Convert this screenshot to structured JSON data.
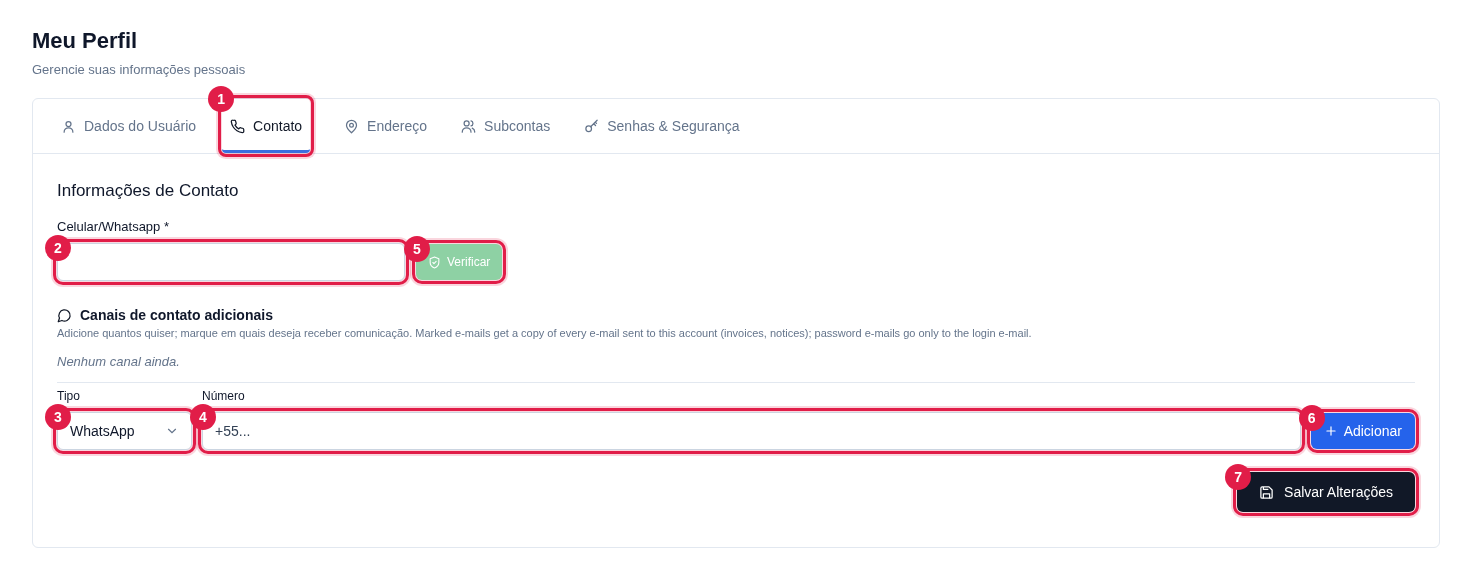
{
  "page": {
    "title": "Meu Perfil",
    "subtitle": "Gerencie suas informações pessoais"
  },
  "tabs": [
    {
      "label": "Dados do Usuário",
      "selected": false
    },
    {
      "label": "Contato",
      "selected": true,
      "marker": "1"
    },
    {
      "label": "Endereço",
      "selected": false
    },
    {
      "label": "Subcontas",
      "selected": false
    },
    {
      "label": "Senhas & Segurança",
      "selected": false
    }
  ],
  "contact": {
    "heading": "Informações de Contato",
    "phone_field": {
      "label": "Celular/Whatsapp *",
      "marker": "2"
    },
    "verify_button": {
      "label": "Verificar",
      "disabled": true,
      "marker": "5"
    },
    "channels": {
      "title": "Canais de contato adicionais",
      "description": "Adicione quantos quiser; marque em quais deseja receber comunicação. Marked e-mails get a copy of every e-mail sent to this account (invoices, notices); password e-mails go only to the login e-mail.",
      "empty_text": "Nenhum canal ainda."
    },
    "type_select": {
      "label": "Tipo",
      "value": "WhatsApp",
      "marker": "3"
    },
    "number_field": {
      "label": "Número",
      "placeholder": "+55...",
      "marker": "4"
    },
    "add_button": {
      "label": "Adicionar",
      "marker": "6"
    },
    "save_button": {
      "label": "Salvar Alterações",
      "marker": "7"
    }
  }
}
